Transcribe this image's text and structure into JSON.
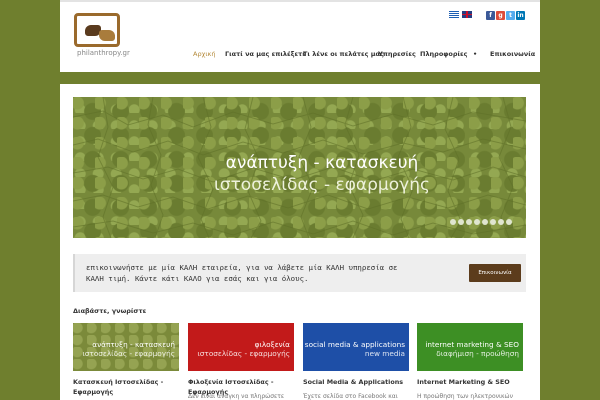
{
  "header": {
    "logo_text": "philanthropy.gr",
    "nav": [
      "Αρχική",
      "Γιατί να μας επιλέξετε",
      "Τι λένε οι πελάτες μας",
      "Υπηρεσίες",
      "Πληροφορίες",
      "•",
      "Επικοινωνία"
    ],
    "active_nav": "Αρχική",
    "flags": [
      "greek-flag-icon",
      "english-flag-icon"
    ],
    "social": [
      {
        "label": "f",
        "icon": "facebook-icon",
        "color": "#3b5998"
      },
      {
        "label": "g",
        "icon": "google-plus-icon",
        "color": "#dd4b39"
      },
      {
        "label": "t",
        "icon": "twitter-icon",
        "color": "#55acee"
      },
      {
        "label": "in",
        "icon": "linkedin-icon",
        "color": "#0077b5"
      }
    ]
  },
  "slider": {
    "line1": "ανάπτυξη - κατασκευή",
    "line2": "ιστοσελίδας - εφαρμογής",
    "dot_count": 8
  },
  "callout": {
    "text": "επικοινωνήστε με μία ΚΑΛΗ εταιρεία, για να λάβετε μία ΚΑΛΗ υπηρεσία σε ΚΑΛΗ τιμή. Κάντε κάτι ΚΑΛΟ για εσάς και για όλους.",
    "button": "Επικοινωνία"
  },
  "section": {
    "title": "Διαβάστε, γνωρίστε",
    "cards": [
      {
        "t1": "ανάπτυξη - κατασκευή",
        "t2": "ιστοσελίδας - εφαρμογής",
        "caption": "Κατασκευή Ιστοσελίδας - Εφαρμογής",
        "excerpt": ""
      },
      {
        "t1": "φιλοξενία",
        "t2": "ιστοσελίδας - εφαρμογής",
        "caption": "Φιλοξενία Ιστοσελίδας - Εφαρμογής",
        "excerpt": "Δεν είναι ανάγκη να πληρώσετε"
      },
      {
        "t1": "social media & applications",
        "t2": "new media",
        "caption": "Social Media & Applications",
        "excerpt": "Έχετε σελίδα στο Facebook και"
      },
      {
        "t1": "internet marketing & SEO",
        "t2": "διαφήμιση - προώθηση",
        "caption": "Internet Marketing & SEO",
        "excerpt": "Η προώθηση των ηλεκτρονικών"
      }
    ]
  },
  "colors": {
    "background": "#6f7f2e",
    "accent": "#b58a3a",
    "cta": "#5c3c1c"
  }
}
